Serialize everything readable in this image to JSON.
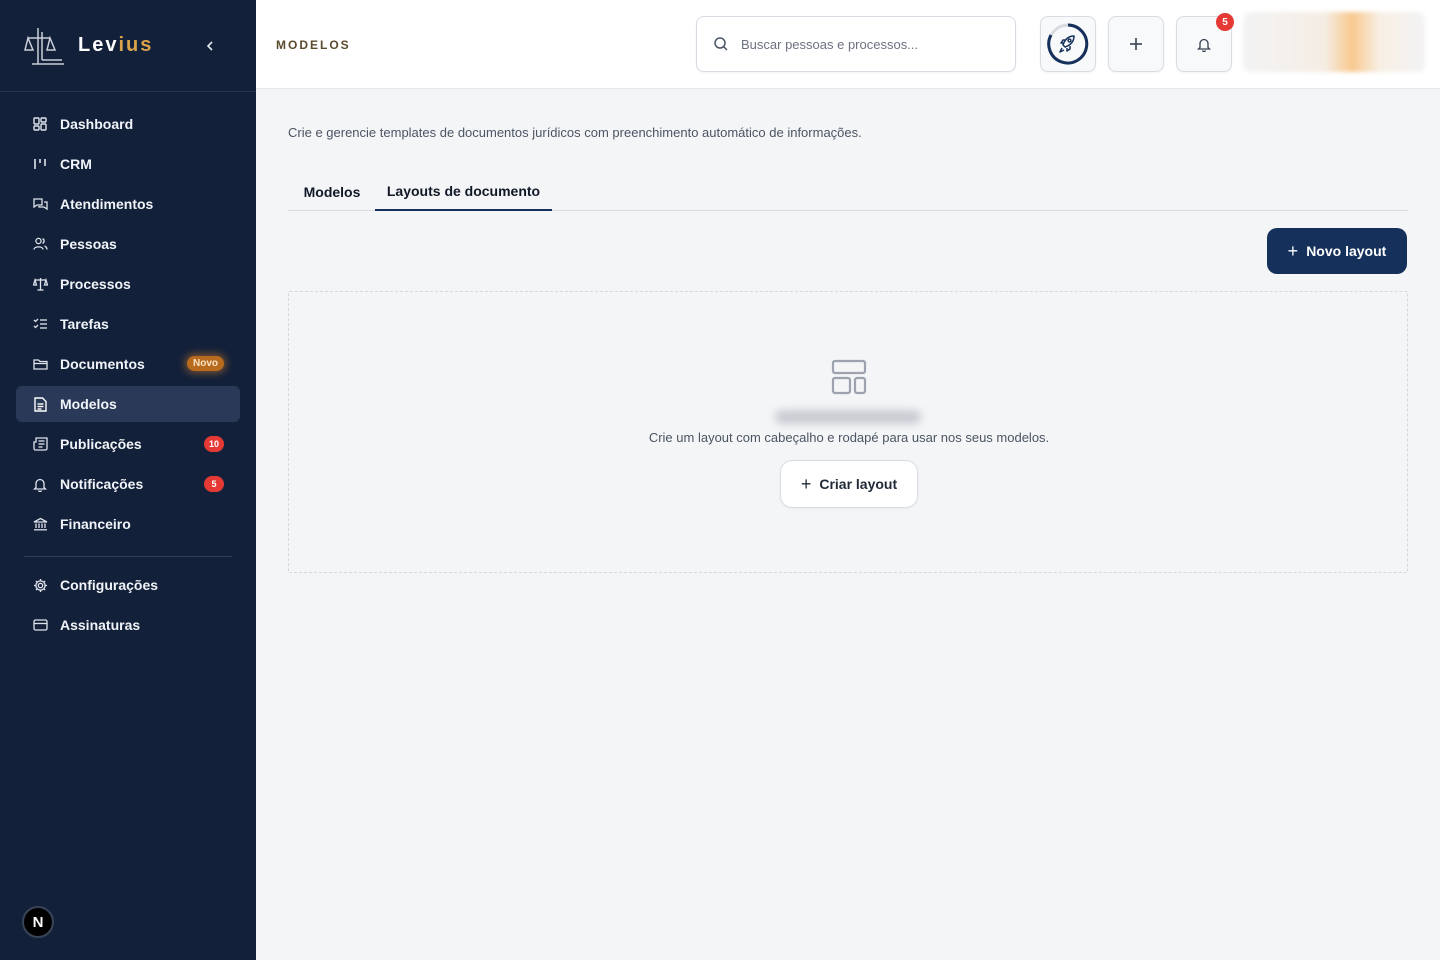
{
  "app": {
    "brand_prefix": "Lev",
    "brand_suffix": "ius"
  },
  "sidebar": {
    "items": [
      {
        "label": "Dashboard",
        "icon": "dashboard-icon"
      },
      {
        "label": "CRM",
        "icon": "kanban-icon"
      },
      {
        "label": "Atendimentos",
        "icon": "chat-icon"
      },
      {
        "label": "Pessoas",
        "icon": "users-icon"
      },
      {
        "label": "Processos",
        "icon": "scale-icon"
      },
      {
        "label": "Tarefas",
        "icon": "list-checks-icon"
      },
      {
        "label": "Documentos",
        "icon": "folder-icon",
        "badge": "Novo"
      },
      {
        "label": "Modelos",
        "icon": "file-text-icon",
        "active": true
      },
      {
        "label": "Publicações",
        "icon": "newspaper-icon",
        "badge": "10"
      },
      {
        "label": "Notificações",
        "icon": "bell-icon",
        "badge": "5"
      },
      {
        "label": "Financeiro",
        "icon": "bank-icon"
      }
    ],
    "bottom_items": [
      {
        "label": "Configurações",
        "icon": "gear-icon"
      },
      {
        "label": "Assinaturas",
        "icon": "credit-card-icon"
      }
    ],
    "user_initial": "N"
  },
  "header": {
    "title": "MODELOS",
    "search_placeholder": "Buscar pessoas e processos...",
    "notification_count": "5"
  },
  "main": {
    "description": "Crie e gerencie templates de documentos jurídicos com preenchimento automático de informações.",
    "tabs": [
      {
        "label": "Modelos",
        "active": false
      },
      {
        "label": "Layouts de documento",
        "active": true
      }
    ],
    "new_button": "Novo layout",
    "empty_state": {
      "description": "Crie um layout com cabeçalho e rodapé para usar nos seus modelos.",
      "button": "Criar layout"
    }
  },
  "colors": {
    "sidebar_bg": "#13203a",
    "primary": "#15305a",
    "accent": "#d8a24a",
    "badge_red": "#e53935",
    "badge_new": "#b86a1f"
  }
}
